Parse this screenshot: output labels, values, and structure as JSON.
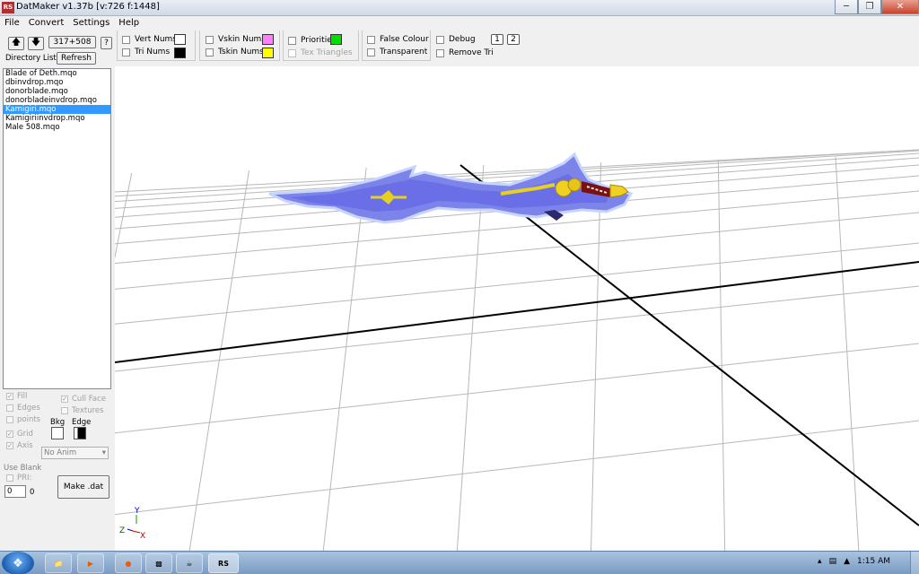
{
  "window": {
    "app_icon": "RS",
    "title": "DatMaker v1.37b  [v:726 f:1448]",
    "minimize_icon": "minimize-icon",
    "maximize_icon": "restore-icon",
    "close_icon": "close-icon"
  },
  "menu": [
    "File",
    "Convert",
    "Settings",
    "Help"
  ],
  "toolbar": {
    "up_icon": "arrow-up-icon",
    "down_icon": "arrow-down-icon",
    "counter": "317+508",
    "help": "?",
    "directory_list": "Directory List",
    "refresh": "Refresh",
    "vert_nums": "Vert Nums",
    "tri_nums": "Tri Nums",
    "vskin_nums": "Vskin Nums",
    "tskin_nums": "Tskin Nums",
    "priorities": "Priorities",
    "tex_triangles": "Tex Triangles",
    "false_colour": "False Colour",
    "transparent": "Transparent",
    "debug": "Debug",
    "remove_tri": "Remove Tri",
    "debug_val1": "1",
    "debug_val2": "2",
    "colors": {
      "vert_nums": "#ffffff",
      "tri_nums": "#000000",
      "vskin_nums": "#ff80ff",
      "tskin_nums": "#ffff00",
      "priorities": "#00e000"
    }
  },
  "files": [
    "Blade of Deth.mqo",
    "dbinvdrop.mqo",
    "donorblade.mqo",
    "donorbladeinvdrop.mqo",
    "Kamigiri.mqo",
    "Kamigiriinvdrop.mqo",
    "Male 508.mqo"
  ],
  "selected_file": "Kamigiri.mqo",
  "render_options": {
    "fill": "Fill",
    "edges": "Edges",
    "points": "points",
    "grid": "Grid",
    "axis": "Axis",
    "cull_face": "Cull Face",
    "textures": "Textures",
    "bkg": "Bkg",
    "edge": "Edge",
    "anim": "No Anim",
    "use_blank": "Use Blank",
    "pri": "PRI:",
    "pri_value": "0",
    "pri_count": "0",
    "make_dat": "Make .dat"
  },
  "axis_labels": {
    "y": "Y",
    "z": "Z",
    "x": "X"
  },
  "taskbar": {
    "clock": "1:15 AM",
    "rs_label": "RS"
  }
}
